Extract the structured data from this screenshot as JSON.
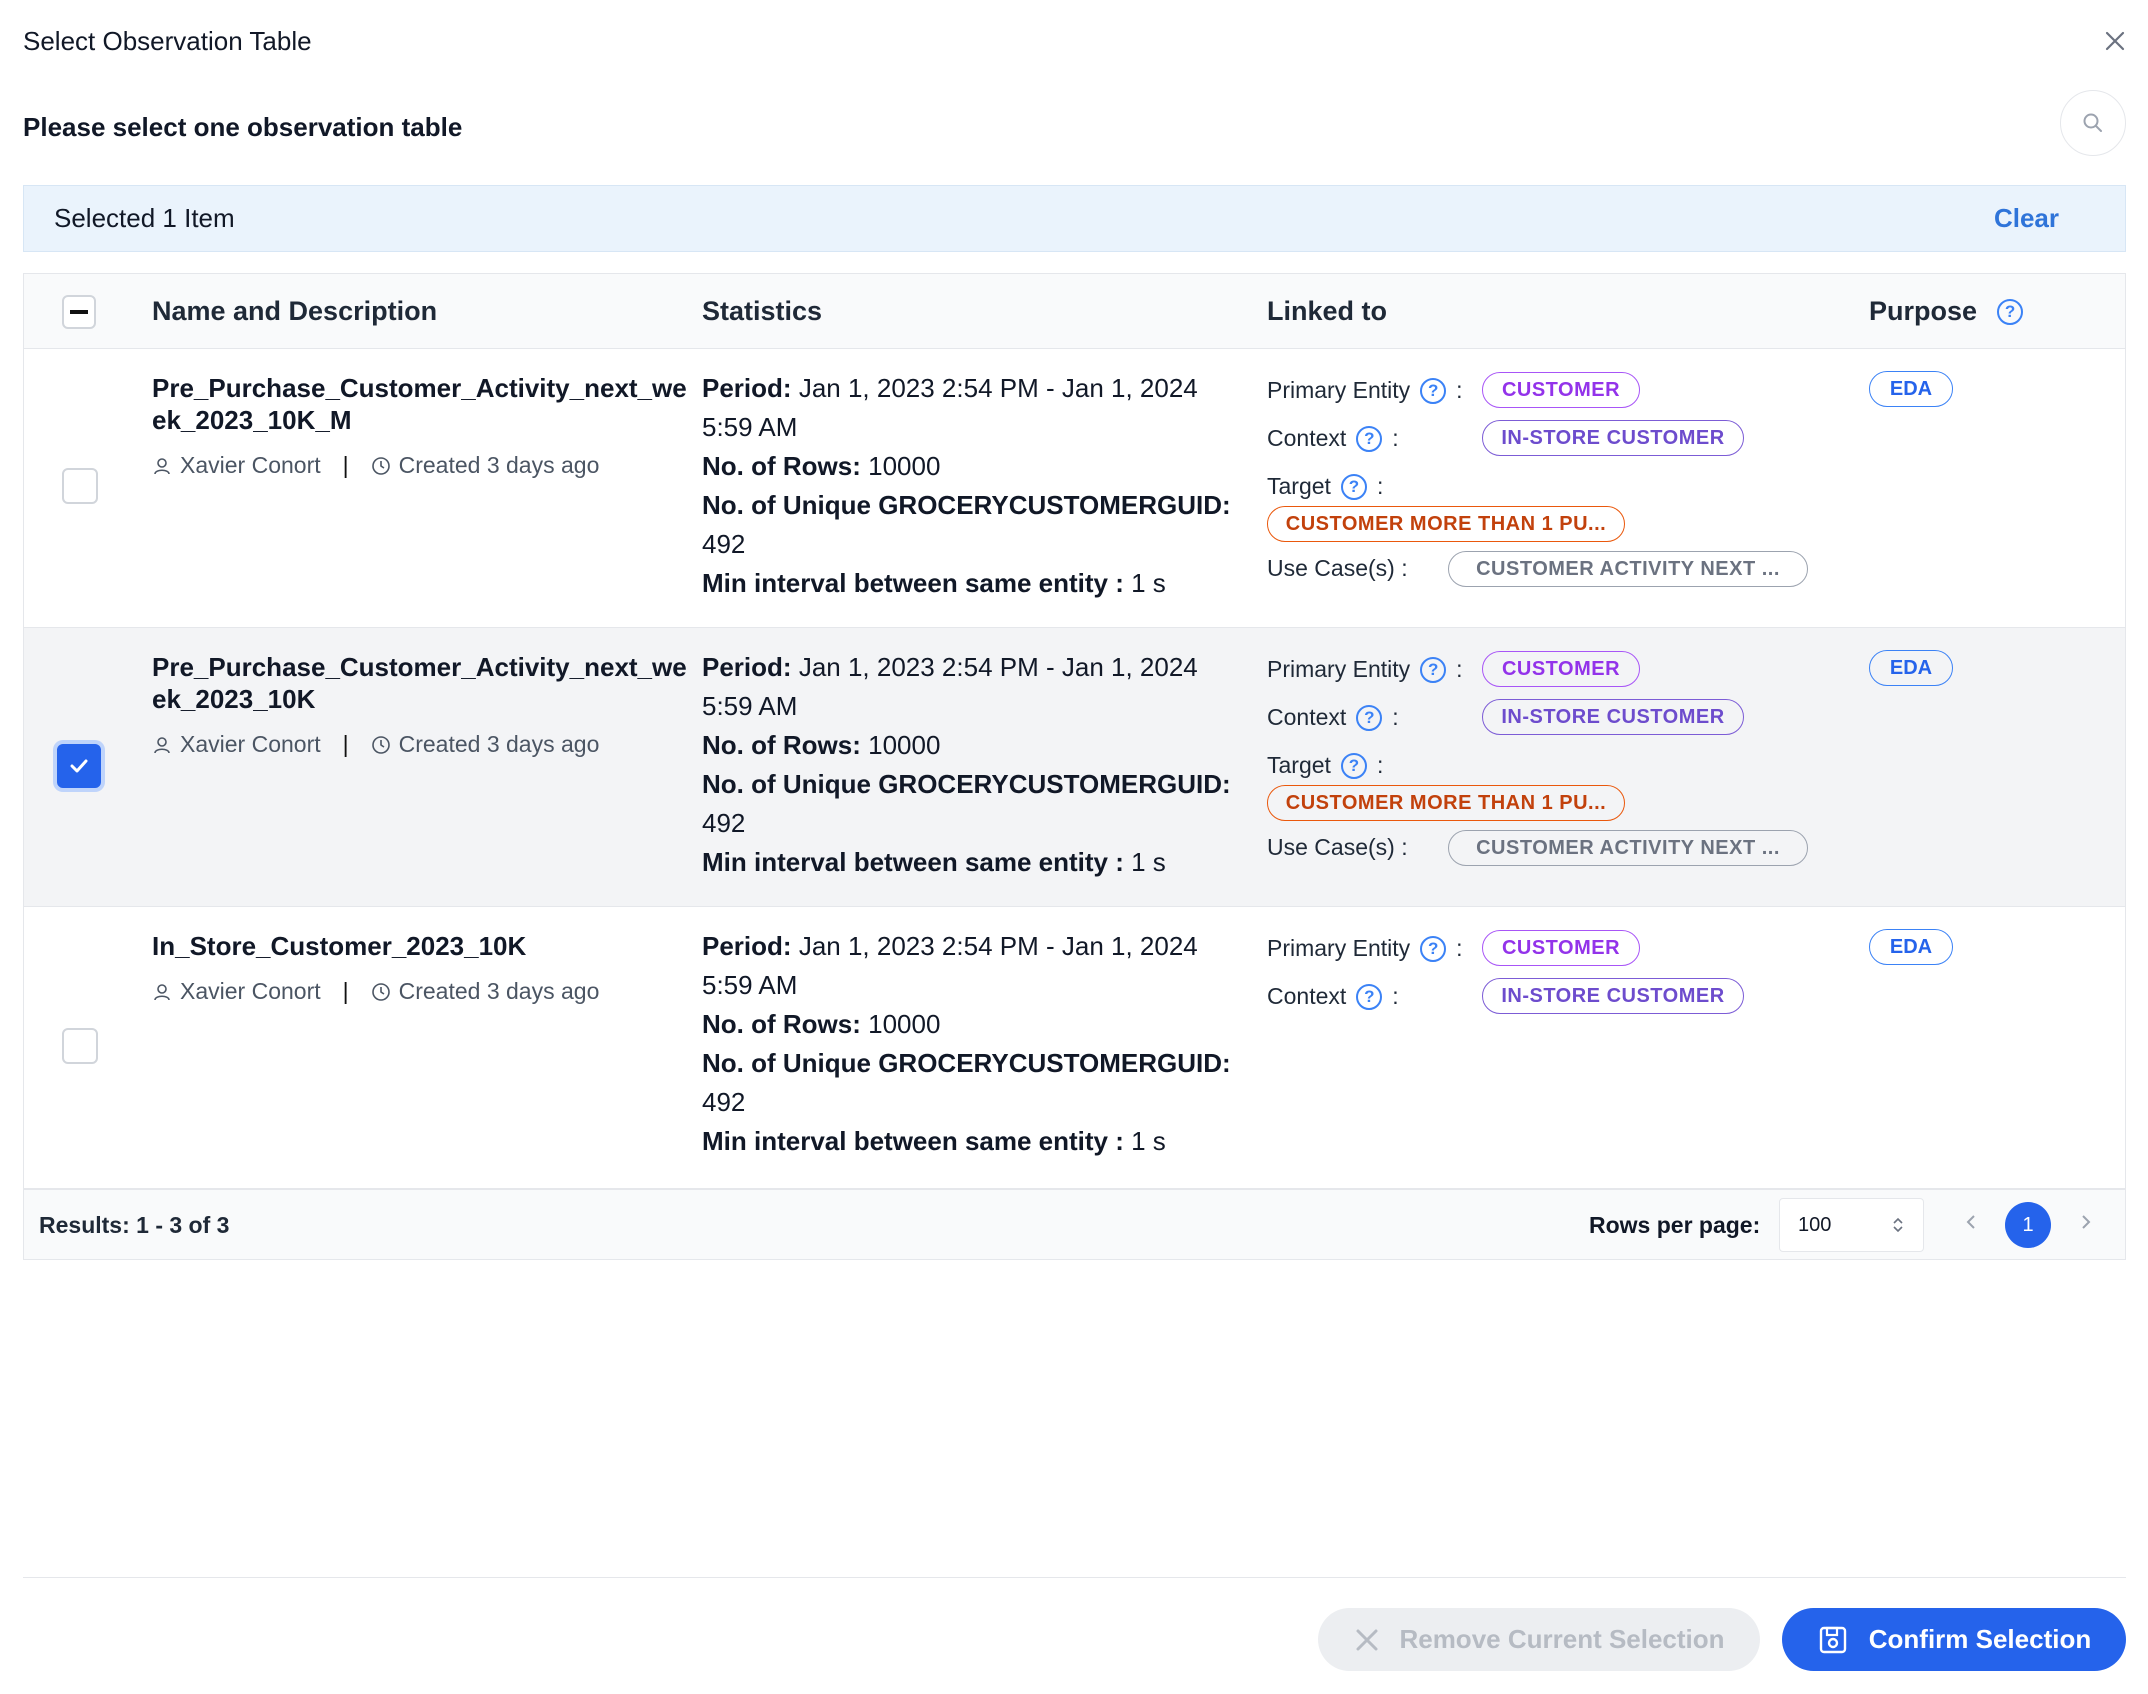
{
  "modal": {
    "title": "Select Observation Table",
    "subtitle": "Please select one observation table"
  },
  "selection": {
    "text": "Selected 1 Item",
    "clear_label": "Clear"
  },
  "table": {
    "columns": [
      "Name and Description",
      "Statistics",
      "Linked to",
      "Purpose"
    ],
    "rows": [
      {
        "name": "Pre_Purchase_Customer_Activity_next_week_2023_10K_M",
        "author": "Xavier Conort",
        "created": "Created 3 days ago",
        "checked": false,
        "stats": {
          "period_label": "Period:",
          "period_value": "Jan 1, 2023 2:54 PM - Jan 1, 2024 5:59 AM",
          "rows_label": "No. of Rows:",
          "rows_value": "10000",
          "unique_label": "No. of Unique GROCERYCUSTOMERGUID:",
          "unique_value": "492",
          "interval_label": "Min interval between same entity :",
          "interval_value": "1 s"
        },
        "linked": {
          "primary_entity_label": "Primary Entity",
          "primary_entity": "CUSTOMER",
          "context_label": "Context",
          "context": "IN-STORE CUSTOMER",
          "target_label": "Target",
          "target": "CUSTOMER MORE THAN 1 PU...",
          "use_case_label": "Use Case(s) :",
          "use_case": "CUSTOMER ACTIVITY NEXT ..."
        },
        "purpose": "EDA"
      },
      {
        "name": "Pre_Purchase_Customer_Activity_next_week_2023_10K",
        "author": "Xavier Conort",
        "created": "Created 3 days ago",
        "checked": true,
        "stats": {
          "period_label": "Period:",
          "period_value": "Jan 1, 2023 2:54 PM - Jan 1, 2024 5:59 AM",
          "rows_label": "No. of Rows:",
          "rows_value": "10000",
          "unique_label": "No. of Unique GROCERYCUSTOMERGUID:",
          "unique_value": "492",
          "interval_label": "Min interval between same entity :",
          "interval_value": "1 s"
        },
        "linked": {
          "primary_entity_label": "Primary Entity",
          "primary_entity": "CUSTOMER",
          "context_label": "Context",
          "context": "IN-STORE CUSTOMER",
          "target_label": "Target",
          "target": "CUSTOMER MORE THAN 1 PU...",
          "use_case_label": "Use Case(s) :",
          "use_case": "CUSTOMER ACTIVITY NEXT ..."
        },
        "purpose": "EDA"
      },
      {
        "name": "In_Store_Customer_2023_10K",
        "author": "Xavier Conort",
        "created": "Created 3 days ago",
        "checked": false,
        "stats": {
          "period_label": "Period:",
          "period_value": "Jan 1, 2023 2:54 PM - Jan 1, 2024 5:59 AM",
          "rows_label": "No. of Rows:",
          "rows_value": "10000",
          "unique_label": "No. of Unique GROCERYCUSTOMERGUID:",
          "unique_value": "492",
          "interval_label": "Min interval between same entity :",
          "interval_value": "1 s"
        },
        "linked": {
          "primary_entity_label": "Primary Entity",
          "primary_entity": "CUSTOMER",
          "context_label": "Context",
          "context": "IN-STORE CUSTOMER"
        },
        "purpose": "EDA"
      }
    ]
  },
  "pagination": {
    "results": "Results: 1 - 3 of 3",
    "rows_per_page_label": "Rows per page:",
    "rows_per_page": "100",
    "current_page": "1"
  },
  "actions": {
    "remove_label": "Remove Current Selection",
    "confirm_label": "Confirm Selection"
  },
  "colors": {
    "accent": "#2563eb",
    "entity_tag": "#9333ea",
    "context_tag": "#6d4ccd",
    "target_tag": "#c2410c",
    "usecase_tag": "#6b7280"
  },
  "icons": [
    "close-icon",
    "search-icon",
    "user-icon",
    "clock-icon",
    "help-icon",
    "check-icon",
    "chevron-left-icon",
    "chevron-right-icon",
    "updown-icon",
    "x-icon",
    "save-icon"
  ]
}
